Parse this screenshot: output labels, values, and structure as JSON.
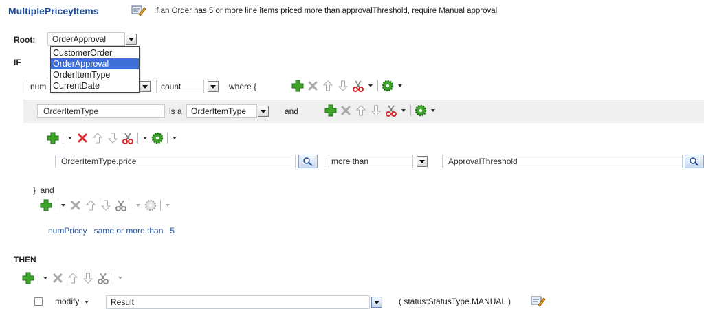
{
  "rule": {
    "name": "MultiplePriceyItems",
    "description": "If an Order has 5 or more line items priced more than approvalThreshold, require Manual approval"
  },
  "root": {
    "label": "Root:",
    "value": "OrderApproval",
    "options": [
      "CustomerOrder",
      "OrderApproval",
      "OrderItemType",
      "CurrentDate"
    ],
    "selected_option": "OrderApproval"
  },
  "if_section": {
    "label": "IF",
    "var_field_partial": "num",
    "count_value": "count",
    "where_text": "where {",
    "pattern": {
      "variable": "OrderItemType",
      "is_a_text": "is a",
      "type_value": "OrderItemType",
      "and_text": "and",
      "condition": {
        "left_value": "OrderItemType.price",
        "operator": "more than",
        "right_value": "ApprovalThreshold"
      }
    },
    "close_text": "}  and",
    "aggregate_condition": "numPricey   same or more than   5"
  },
  "then_section": {
    "label": "THEN",
    "action_verb": "modify",
    "action_target": "Result",
    "action_expr": "( status:StatusType.MANUAL )"
  },
  "colors": {
    "title_blue": "#1f4e9a",
    "add_green": "#3ea52a",
    "delete_red": "#d8262b",
    "disabled_gray": "#a9a9a9",
    "selection_blue": "#3d6fd6",
    "row_highlight": "#efefef"
  },
  "icons": [
    "edit-pencil-icon",
    "add-plus-icon",
    "delete-x-icon",
    "move-up-icon",
    "move-down-icon",
    "cut-scissors-icon",
    "settings-gear-icon",
    "search-icon",
    "menu-arrow-icon"
  ]
}
